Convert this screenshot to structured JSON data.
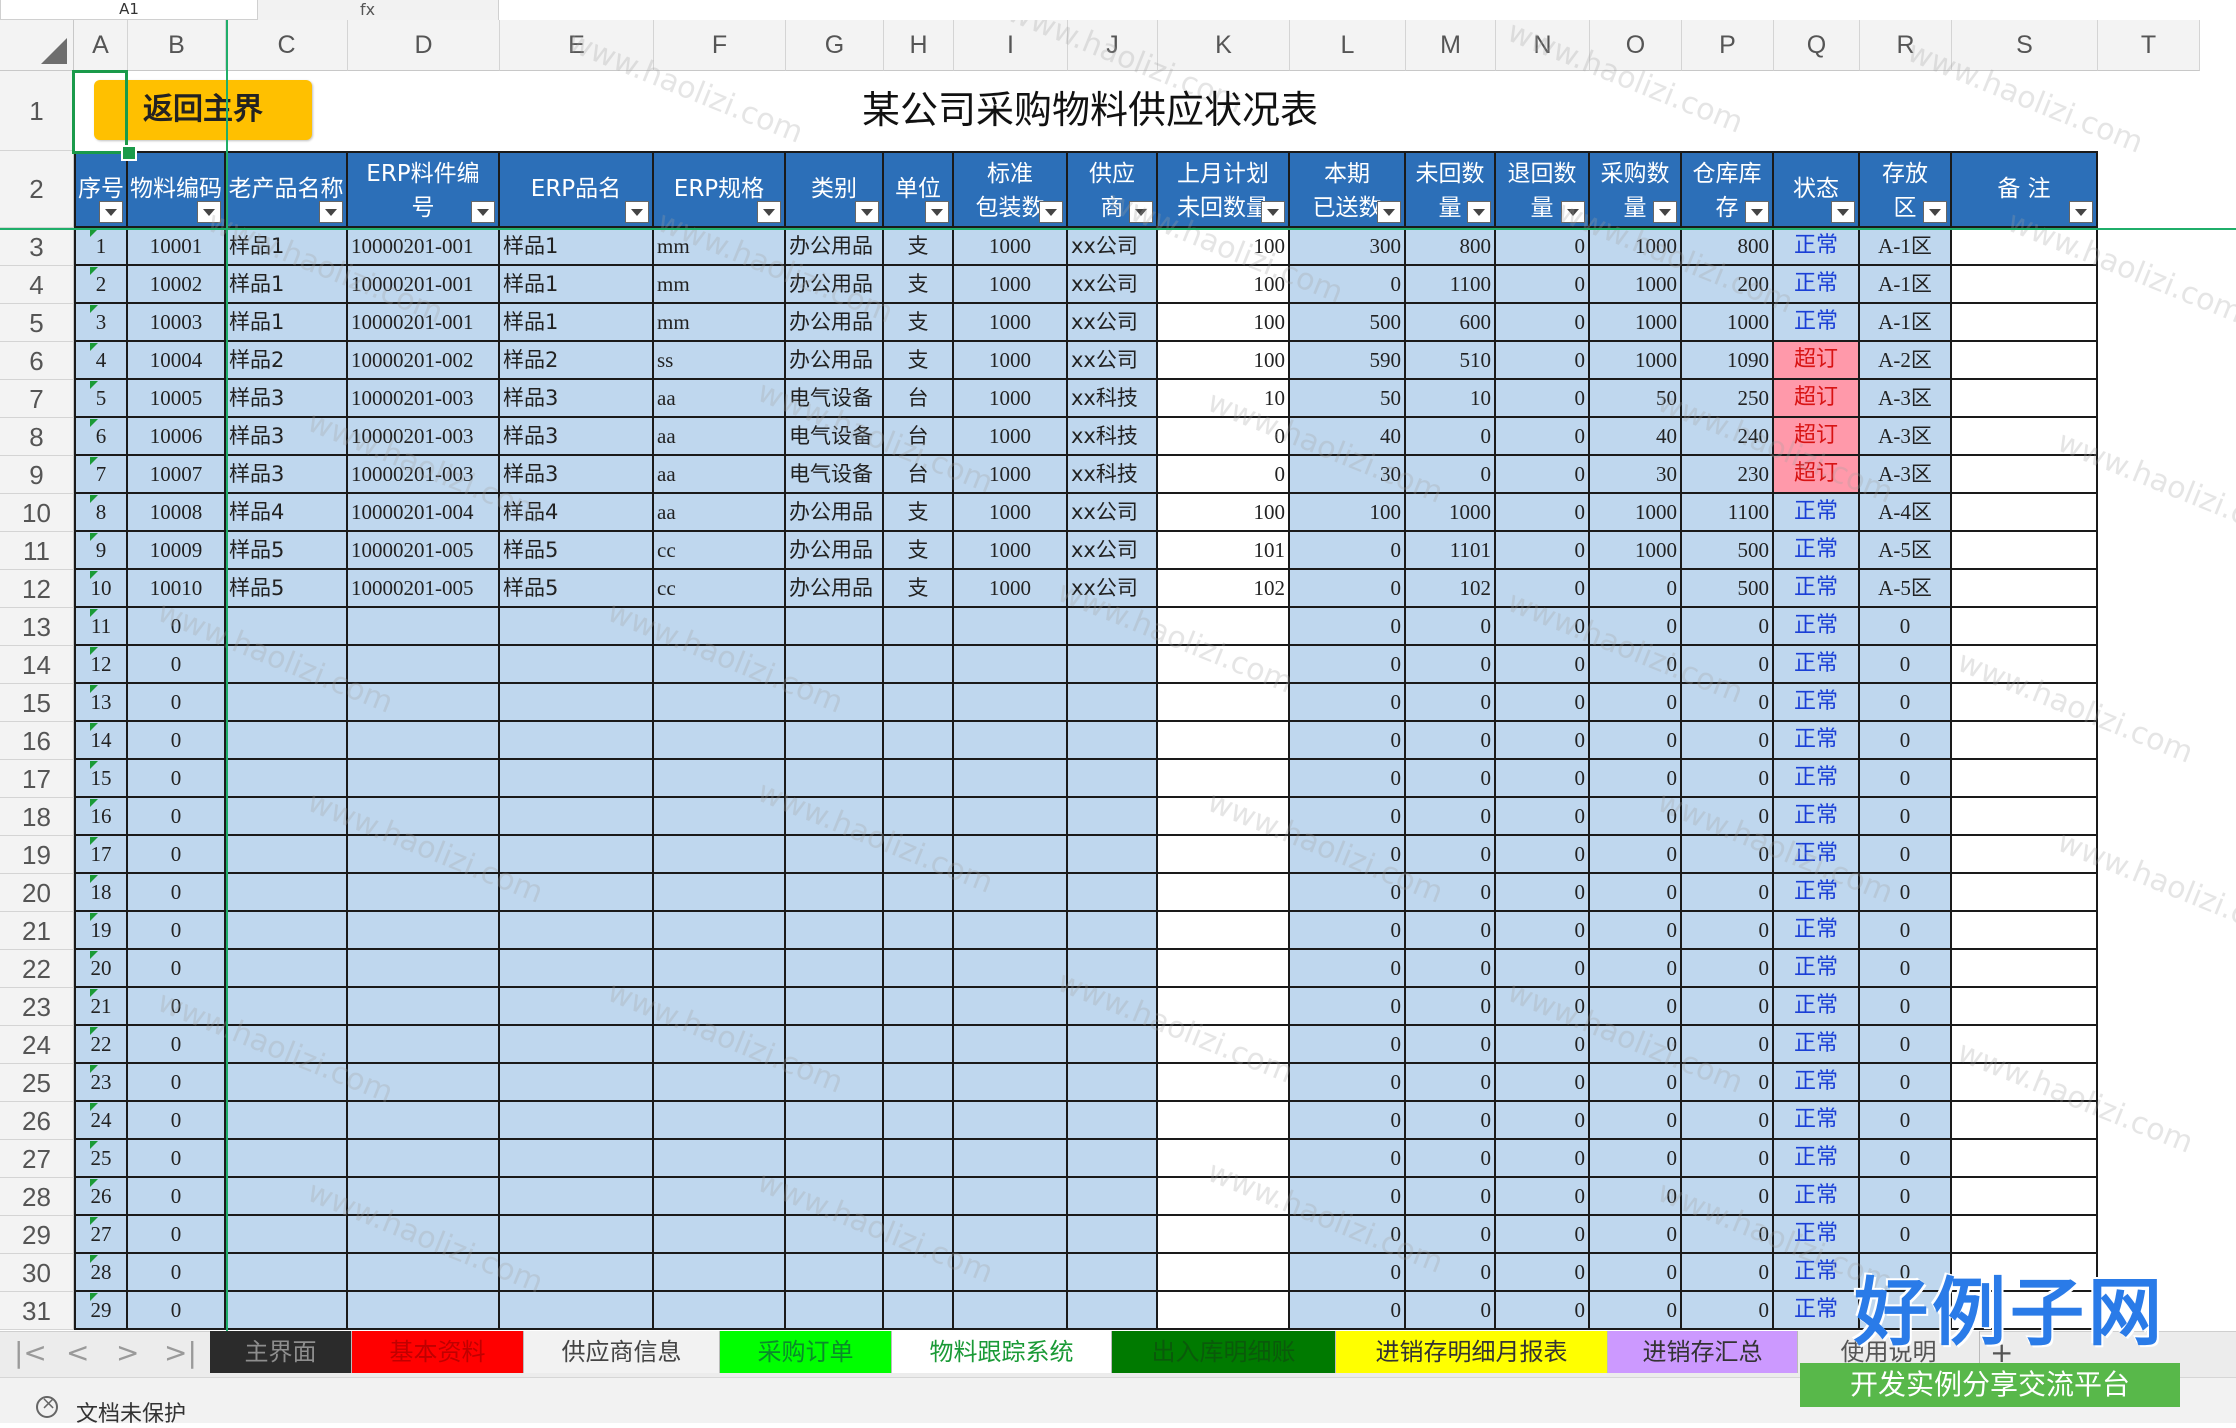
{
  "name_box": "A1",
  "formula_icon": "fx",
  "columns": [
    "A",
    "B",
    "C",
    "D",
    "E",
    "F",
    "G",
    "H",
    "I",
    "J",
    "K",
    "L",
    "M",
    "N",
    "O",
    "P",
    "Q",
    "R",
    "S",
    "T"
  ],
  "back_button": "返回主界",
  "title": "某公司采购物料供应状况表",
  "headers": [
    "序号",
    "物料编码",
    "老产品名称",
    "ERP料件编号",
    "ERP品名",
    "ERP规格",
    "类别",
    "单位",
    "标准包装数",
    "供应商",
    "上月计划未回数量",
    "本期已送数",
    "未回数量",
    "退回数量",
    "采购数量",
    "仓库库存",
    "状态",
    "存放区",
    "备 注"
  ],
  "header_display": [
    [
      "序号"
    ],
    [
      "物料编码"
    ],
    [
      "老产品名称"
    ],
    [
      "ERP料件编",
      "号"
    ],
    [
      "ERP品名"
    ],
    [
      "ERP规格"
    ],
    [
      "类别"
    ],
    [
      "单位"
    ],
    [
      "标准",
      "包装数"
    ],
    [
      "供应",
      "商"
    ],
    [
      "上月计划",
      "未回数量"
    ],
    [
      "本期",
      "已送数"
    ],
    [
      "未回数",
      "量"
    ],
    [
      "退回数",
      "量"
    ],
    [
      "采购数",
      "量"
    ],
    [
      "仓库库",
      "存"
    ],
    [
      "状态"
    ],
    [
      "存放",
      "区"
    ],
    [
      "备  注"
    ]
  ],
  "data_rows": [
    [
      "1",
      "10001",
      "样品1",
      "10000201-001",
      "样品1",
      "mm",
      "办公用品",
      "支",
      "1000",
      "xx公司",
      "100",
      "300",
      "800",
      "0",
      "1000",
      "800",
      "正常",
      "A-1区",
      ""
    ],
    [
      "2",
      "10002",
      "样品1",
      "10000201-001",
      "样品1",
      "mm",
      "办公用品",
      "支",
      "1000",
      "xx公司",
      "100",
      "0",
      "1100",
      "0",
      "1000",
      "200",
      "正常",
      "A-1区",
      ""
    ],
    [
      "3",
      "10003",
      "样品1",
      "10000201-001",
      "样品1",
      "mm",
      "办公用品",
      "支",
      "1000",
      "xx公司",
      "100",
      "500",
      "600",
      "0",
      "1000",
      "1000",
      "正常",
      "A-1区",
      ""
    ],
    [
      "4",
      "10004",
      "样品2",
      "10000201-002",
      "样品2",
      "ss",
      "办公用品",
      "支",
      "1000",
      "xx公司",
      "100",
      "590",
      "510",
      "0",
      "1000",
      "1090",
      "超订",
      "A-2区",
      ""
    ],
    [
      "5",
      "10005",
      "样品3",
      "10000201-003",
      "样品3",
      "aa",
      "电气设备",
      "台",
      "1000",
      "xx科技",
      "10",
      "50",
      "10",
      "0",
      "50",
      "250",
      "超订",
      "A-3区",
      ""
    ],
    [
      "6",
      "10006",
      "样品3",
      "10000201-003",
      "样品3",
      "aa",
      "电气设备",
      "台",
      "1000",
      "xx科技",
      "0",
      "40",
      "0",
      "0",
      "40",
      "240",
      "超订",
      "A-3区",
      ""
    ],
    [
      "7",
      "10007",
      "样品3",
      "10000201-003",
      "样品3",
      "aa",
      "电气设备",
      "台",
      "1000",
      "xx科技",
      "0",
      "30",
      "0",
      "0",
      "30",
      "230",
      "超订",
      "A-3区",
      ""
    ],
    [
      "8",
      "10008",
      "样品4",
      "10000201-004",
      "样品4",
      "aa",
      "办公用品",
      "支",
      "1000",
      "xx公司",
      "100",
      "100",
      "1000",
      "0",
      "1000",
      "1100",
      "正常",
      "A-4区",
      ""
    ],
    [
      "9",
      "10009",
      "样品5",
      "10000201-005",
      "样品5",
      "cc",
      "办公用品",
      "支",
      "1000",
      "xx公司",
      "101",
      "0",
      "1101",
      "0",
      "1000",
      "500",
      "正常",
      "A-5区",
      ""
    ],
    [
      "10",
      "10010",
      "样品5",
      "10000201-005",
      "样品5",
      "cc",
      "办公用品",
      "支",
      "1000",
      "xx公司",
      "102",
      "0",
      "102",
      "0",
      "0",
      "500",
      "正常",
      "A-5区",
      ""
    ]
  ],
  "empty_row_ids": [
    "11",
    "12",
    "13",
    "14",
    "15",
    "16",
    "17",
    "18",
    "19",
    "20",
    "21",
    "22",
    "23",
    "24",
    "25",
    "26",
    "27",
    "28",
    "29"
  ],
  "zero": "0",
  "status_ok": "正常",
  "row_numbers": [
    "1",
    "2",
    "3",
    "4",
    "5",
    "6",
    "7",
    "8",
    "9",
    "10",
    "11",
    "12",
    "13",
    "14",
    "15",
    "16",
    "17",
    "18",
    "19",
    "20",
    "21",
    "22",
    "23",
    "24",
    "25",
    "26",
    "27",
    "28",
    "29",
    "30",
    "31"
  ],
  "tabs": [
    {
      "label": "主界面",
      "bg": "#2b2b2b",
      "fg": "#8e8e8e"
    },
    {
      "label": "基本资料",
      "bg": "#ff0000",
      "fg": "#c00000"
    },
    {
      "label": "供应商信息",
      "bg": "#f2f2f2",
      "fg": "#444444"
    },
    {
      "label": "采购订单",
      "bg": "#00ff00",
      "fg": "#0a8a2a"
    },
    {
      "label": "物料跟踪系统",
      "bg": "#ffffff",
      "fg": "#1a9a36"
    },
    {
      "label": "出入库明细账",
      "bg": "#007a00",
      "fg": "#0a5a0a"
    },
    {
      "label": "进销存明细月报表",
      "bg": "#ffff00",
      "fg": "#333333"
    },
    {
      "label": "进销存汇总",
      "bg": "#cc99ff",
      "fg": "#333333"
    },
    {
      "label": "使用说明",
      "bg": "#ececec",
      "fg": "#555555"
    }
  ],
  "add_sheet": "+",
  "nav": [
    "|<",
    "<",
    ">",
    ">|"
  ],
  "status": "文档未保护",
  "watermark": "www.haolizi.com",
  "logo_title": "好例子网",
  "logo_sub": "开发实例分享交流平台",
  "colors": {
    "header_blue": "#2c6fb8",
    "cell_blue": "#bfd7ee",
    "over_pink": "#ff99aa",
    "button_gold": "#ffc000"
  }
}
